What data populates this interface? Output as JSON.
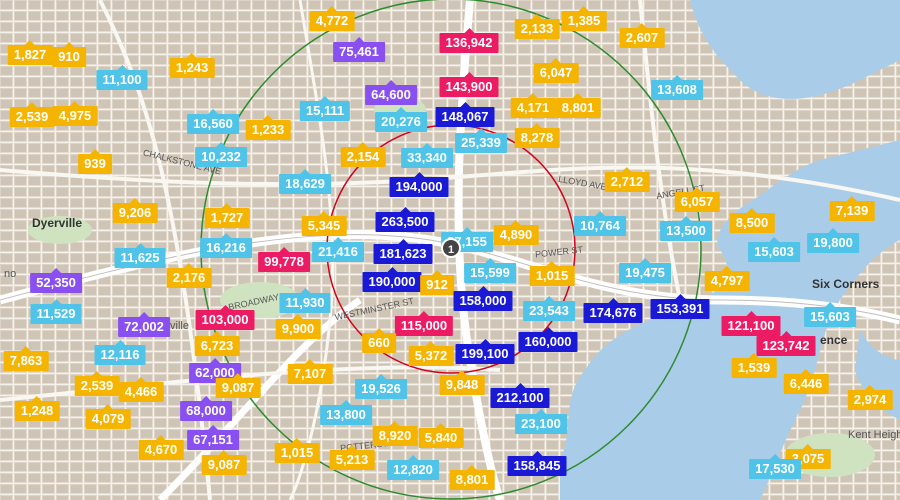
{
  "colors": {
    "yellow": "#f4b400",
    "cyan": "#4fc3e8",
    "blue": "#1a1ad6",
    "purple": "#8a4ff0",
    "pink": "#ec1c64",
    "inner_ring": "#d0021b",
    "outer_ring": "#2e8b2e",
    "water": "#a9cde8"
  },
  "center_marker": {
    "label": "1"
  },
  "places": [
    "Dyerville",
    "Six Corners",
    "Kent Heigh",
    "no",
    "ville",
    "ence"
  ],
  "street_names": [
    "CHALKSTONE AVE",
    "ANGELL ST",
    "LLOYD AVE",
    "POWER ST",
    "BROADWAY",
    "WESTMINSTER ST",
    "POTTERS AVE"
  ],
  "price_labels": [
    {
      "value": "4,772",
      "color": "yellow"
    },
    {
      "value": "136,942",
      "color": "pink"
    },
    {
      "value": "2,133",
      "color": "yellow"
    },
    {
      "value": "1,385",
      "color": "yellow"
    },
    {
      "value": "1,827",
      "color": "yellow"
    },
    {
      "value": "910",
      "color": "yellow"
    },
    {
      "value": "75,461",
      "color": "purple"
    },
    {
      "value": "2,607",
      "color": "yellow"
    },
    {
      "value": "11,100",
      "color": "cyan"
    },
    {
      "value": "1,243",
      "color": "yellow"
    },
    {
      "value": "143,900",
      "color": "pink"
    },
    {
      "value": "6,047",
      "color": "yellow"
    },
    {
      "value": "64,600",
      "color": "purple"
    },
    {
      "value": "13,608",
      "color": "cyan"
    },
    {
      "value": "2,539",
      "color": "yellow"
    },
    {
      "value": "4,975",
      "color": "yellow"
    },
    {
      "value": "15,111",
      "color": "cyan"
    },
    {
      "value": "4,171",
      "color": "yellow"
    },
    {
      "value": "8,801",
      "color": "yellow"
    },
    {
      "value": "20,276",
      "color": "cyan"
    },
    {
      "value": "148,067",
      "color": "blue"
    },
    {
      "value": "16,560",
      "color": "cyan"
    },
    {
      "value": "1,233",
      "color": "yellow"
    },
    {
      "value": "8,278",
      "color": "yellow"
    },
    {
      "value": "25,339",
      "color": "cyan"
    },
    {
      "value": "10,232",
      "color": "cyan"
    },
    {
      "value": "2,154",
      "color": "yellow"
    },
    {
      "value": "33,340",
      "color": "cyan"
    },
    {
      "value": "939",
      "color": "yellow"
    },
    {
      "value": "18,629",
      "color": "cyan"
    },
    {
      "value": "194,000",
      "color": "blue"
    },
    {
      "value": "2,712",
      "color": "yellow"
    },
    {
      "value": "6,057",
      "color": "yellow"
    },
    {
      "value": "9,206",
      "color": "yellow"
    },
    {
      "value": "1,727",
      "color": "yellow"
    },
    {
      "value": "5,345",
      "color": "yellow"
    },
    {
      "value": "263,500",
      "color": "blue"
    },
    {
      "value": "8,500",
      "color": "yellow"
    },
    {
      "value": "7,139",
      "color": "yellow"
    },
    {
      "value": "10,764",
      "color": "cyan"
    },
    {
      "value": "13,500",
      "color": "cyan"
    },
    {
      "value": "16,216",
      "color": "cyan"
    },
    {
      "value": "21,416",
      "color": "cyan"
    },
    {
      "value": "181,623",
      "color": "blue"
    },
    {
      "value": "27,155",
      "color": "cyan"
    },
    {
      "value": "4,890",
      "color": "yellow"
    },
    {
      "value": "15,603",
      "color": "cyan"
    },
    {
      "value": "19,800",
      "color": "cyan"
    },
    {
      "value": "11,625",
      "color": "cyan"
    },
    {
      "value": "99,778",
      "color": "pink"
    },
    {
      "value": "190,000",
      "color": "blue"
    },
    {
      "value": "912",
      "color": "yellow"
    },
    {
      "value": "15,599",
      "color": "cyan"
    },
    {
      "value": "1,015",
      "color": "yellow"
    },
    {
      "value": "19,475",
      "color": "cyan"
    },
    {
      "value": "52,350",
      "color": "purple"
    },
    {
      "value": "2,176",
      "color": "yellow"
    },
    {
      "value": "4,797",
      "color": "yellow"
    },
    {
      "value": "11,529",
      "color": "cyan"
    },
    {
      "value": "11,930",
      "color": "cyan"
    },
    {
      "value": "158,000",
      "color": "blue"
    },
    {
      "value": "23,543",
      "color": "cyan"
    },
    {
      "value": "174,676",
      "color": "blue"
    },
    {
      "value": "153,391",
      "color": "blue"
    },
    {
      "value": "15,603",
      "color": "cyan"
    },
    {
      "value": "72,002",
      "color": "purple"
    },
    {
      "value": "103,000",
      "color": "pink"
    },
    {
      "value": "9,900",
      "color": "yellow"
    },
    {
      "value": "115,000",
      "color": "pink"
    },
    {
      "value": "121,100",
      "color": "pink"
    },
    {
      "value": "160,000",
      "color": "blue"
    },
    {
      "value": "123,742",
      "color": "pink"
    },
    {
      "value": "6,723",
      "color": "yellow"
    },
    {
      "value": "660",
      "color": "yellow"
    },
    {
      "value": "7,863",
      "color": "yellow"
    },
    {
      "value": "12,116",
      "color": "cyan"
    },
    {
      "value": "5,372",
      "color": "yellow"
    },
    {
      "value": "199,100",
      "color": "blue"
    },
    {
      "value": "1,539",
      "color": "yellow"
    },
    {
      "value": "62,000",
      "color": "purple"
    },
    {
      "value": "7,107",
      "color": "yellow"
    },
    {
      "value": "2,539",
      "color": "yellow"
    },
    {
      "value": "9,087",
      "color": "yellow"
    },
    {
      "value": "4,466",
      "color": "yellow"
    },
    {
      "value": "19,526",
      "color": "cyan"
    },
    {
      "value": "9,848",
      "color": "yellow"
    },
    {
      "value": "6,446",
      "color": "yellow"
    },
    {
      "value": "212,100",
      "color": "blue"
    },
    {
      "value": "2,974",
      "color": "yellow"
    },
    {
      "value": "1,248",
      "color": "yellow"
    },
    {
      "value": "68,000",
      "color": "purple"
    },
    {
      "value": "4,079",
      "color": "yellow"
    },
    {
      "value": "13,800",
      "color": "cyan"
    },
    {
      "value": "23,100",
      "color": "cyan"
    },
    {
      "value": "8,920",
      "color": "yellow"
    },
    {
      "value": "5,840",
      "color": "yellow"
    },
    {
      "value": "67,151",
      "color": "purple"
    },
    {
      "value": "4,670",
      "color": "yellow"
    },
    {
      "value": "1,015",
      "color": "yellow"
    },
    {
      "value": "5,213",
      "color": "yellow"
    },
    {
      "value": "12,820",
      "color": "cyan"
    },
    {
      "value": "158,845",
      "color": "blue"
    },
    {
      "value": "3,075",
      "color": "yellow"
    },
    {
      "value": "9,087",
      "color": "yellow"
    },
    {
      "value": "8,801",
      "color": "yellow"
    },
    {
      "value": "17,530",
      "color": "cyan"
    }
  ]
}
